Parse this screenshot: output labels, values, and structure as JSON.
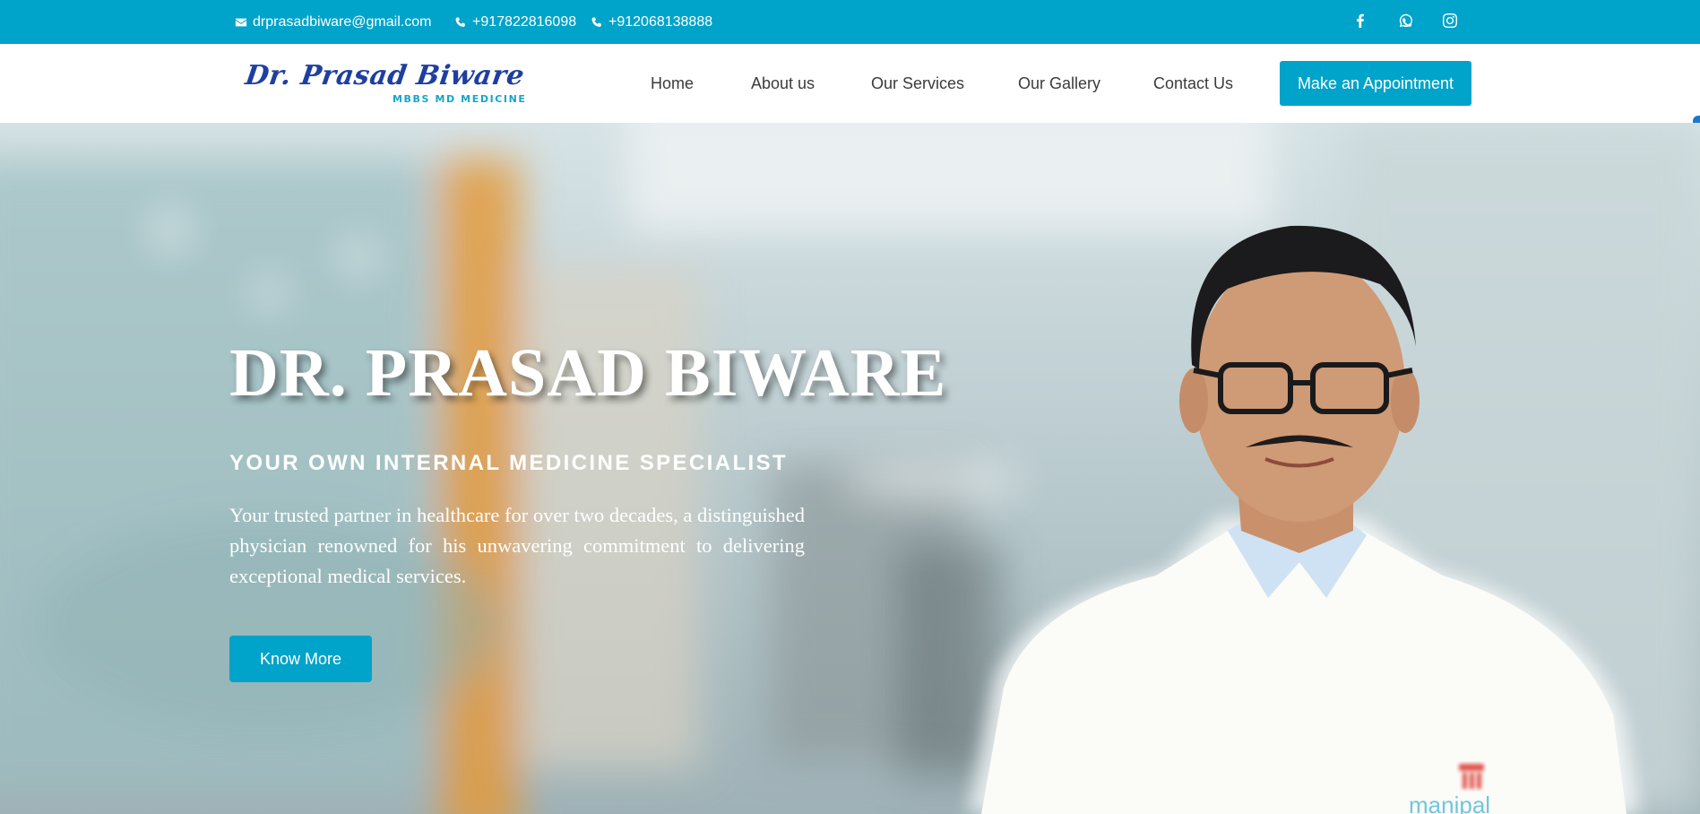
{
  "topbar": {
    "email": "drprasadbiware@gmail.com",
    "phone1": "+917822816098",
    "phone2": "+912068138888",
    "email_icon": "envelope-icon",
    "phone_icon": "phone-icon",
    "social_icons": [
      "facebook-icon",
      "whatsapp-icon",
      "instagram-icon"
    ]
  },
  "logo": {
    "name": "Dr. Prasad Biware",
    "subtitle": "MBBS MD MEDICINE"
  },
  "nav": {
    "items": [
      "Home",
      "About us",
      "Our Services",
      "Our Gallery",
      "Contact Us"
    ],
    "cta": "Make an Appointment"
  },
  "hero": {
    "title": "DR. PRASAD BIWARE",
    "subtitle": "YOUR OWN INTERNAL MEDICINE SPECIALIST",
    "description": "Your trusted partner in healthcare for over two decades, a distinguished physician renowned for his unwavering commitment to delivering exceptional medical services.",
    "button": "Know More",
    "coat_text": "manipal"
  },
  "colors": {
    "accent": "#00a3c9",
    "logo_blue": "#1e3fa0",
    "nav_text": "#3b3b3b"
  }
}
